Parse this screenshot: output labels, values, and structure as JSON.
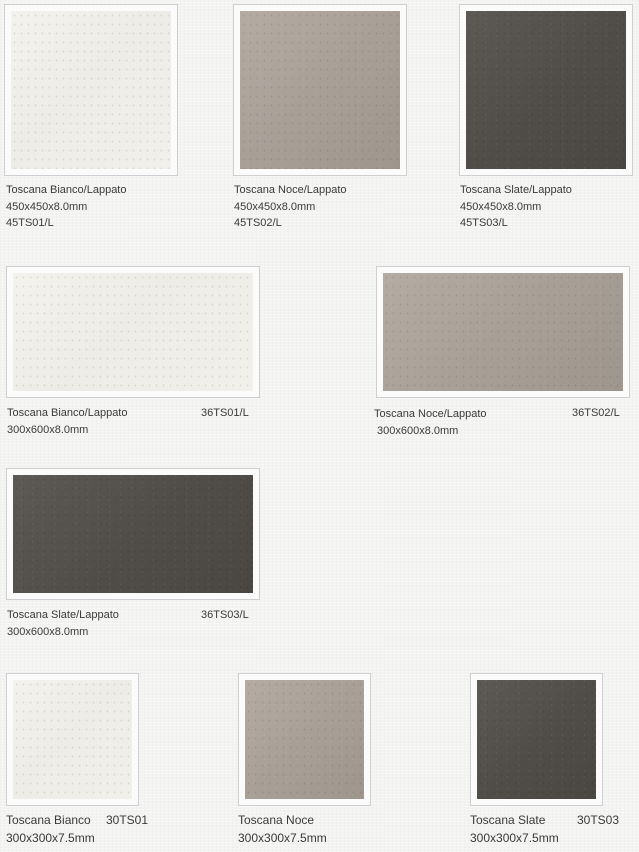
{
  "products": [
    {
      "name": "Toscana Bianco/Lappato",
      "size": "450x450x8.0mm",
      "code": "45TS01/L",
      "finish": "bianco"
    },
    {
      "name": "Toscana Noce/Lappato",
      "size": "450x450x8.0mm",
      "code": "45TS02/L",
      "finish": "noce"
    },
    {
      "name": "Toscana Slate/Lappato",
      "size": "450x450x8.0mm",
      "code": "45TS03/L",
      "finish": "slate"
    },
    {
      "name": "Toscana Bianco/Lappato",
      "size": "300x600x8.0mm",
      "code": "36TS01/L",
      "finish": "bianco"
    },
    {
      "name": "Toscana Noce/Lappato",
      "size": "300x600x8.0mm",
      "code": "36TS02/L",
      "finish": "noce"
    },
    {
      "name": "Toscana Slate/Lappato",
      "size": "300x600x8.0mm",
      "code": "36TS03/L",
      "finish": "slate"
    },
    {
      "name": "Toscana Bianco",
      "size": "300x300x7.5mm",
      "code": "30TS01",
      "finish": "bianco"
    },
    {
      "name": "Toscana Noce",
      "size": "300x300x7.5mm",
      "code": "",
      "finish": "noce"
    },
    {
      "name": "Toscana Slate",
      "size": "300x300x7.5mm",
      "code": "30TS03",
      "finish": "slate"
    }
  ],
  "colors": {
    "bianco": "#f1efe9",
    "noce": "#a8a097",
    "slate": "#514d49",
    "border": "#cfcfcf"
  }
}
